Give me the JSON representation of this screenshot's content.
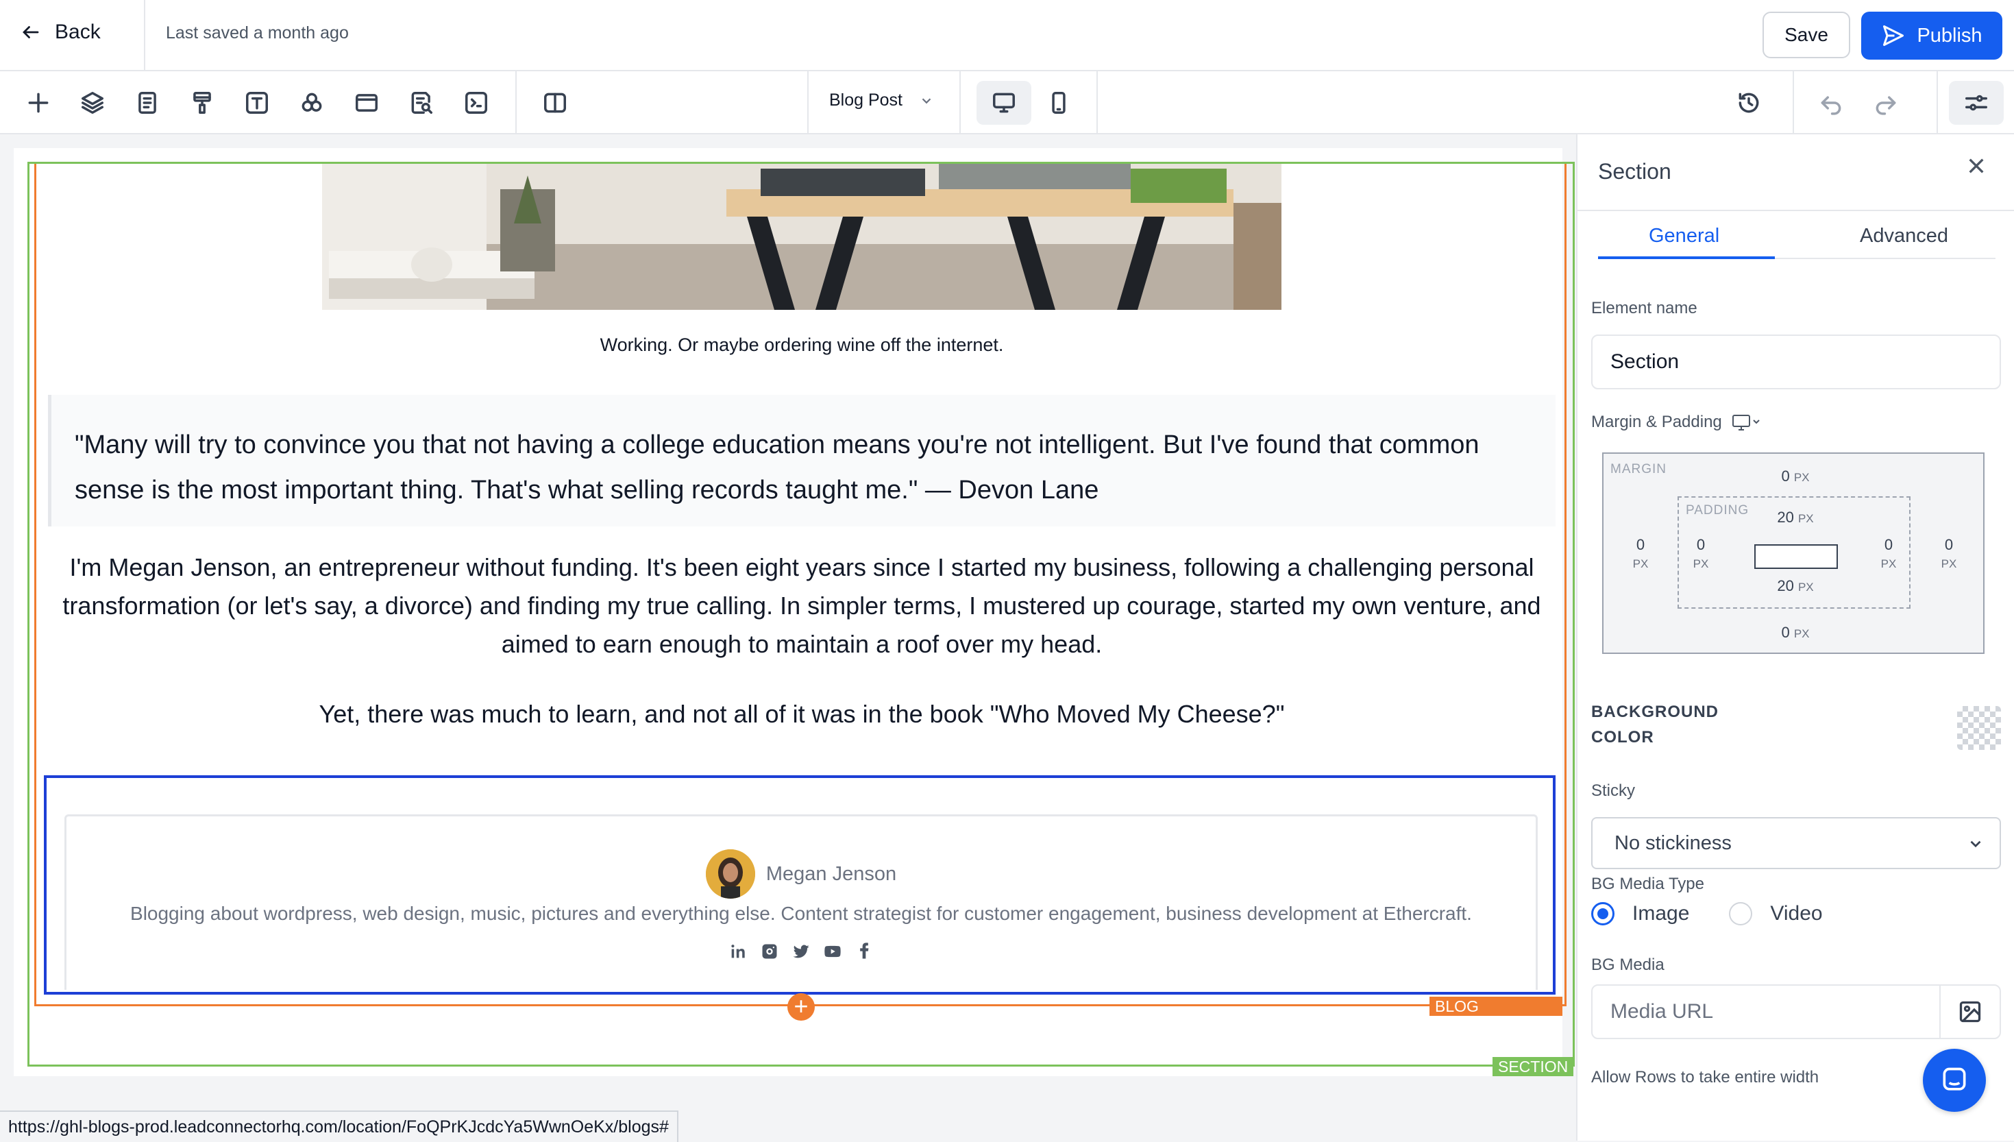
{
  "header": {
    "back_label": "Back",
    "last_saved": "Last saved a month ago",
    "save_label": "Save",
    "publish_label": "Publish"
  },
  "toolbar": {
    "page_select": "Blog Post",
    "left_icons": [
      "plus-icon",
      "layers-icon",
      "page-icon",
      "paint-roller-icon",
      "text-icon",
      "components-icon",
      "window-icon",
      "search-document-icon",
      "code-terminal-icon",
      "split-view-icon"
    ],
    "device": "desktop"
  },
  "canvas": {
    "caption": "Working. Or maybe ordering wine off the internet.",
    "quote": "\"Many will try to convince you that not having a college education means you're not intelligent. But I've found that common sense is the most important thing. That's what selling records taught me.\" — Devon Lane",
    "paragraph1": "I'm Megan Jenson, an entrepreneur without funding. It's been eight years since I started my business, following a challenging personal transformation (or let's say, a divorce) and finding my true calling. In simpler terms, I mustered up courage, started my own venture, and aimed to earn enough to maintain a roof over my head.",
    "paragraph2": "Yet, there was much to learn, and not all of it was in the book \"Who Moved My Cheese?\"",
    "author": {
      "name": "Megan Jenson",
      "bio": "Blogging about wordpress, web design, music, pictures and everything else. Content strategist for customer engagement, business development at Ethercraft.",
      "socials": [
        "linkedin-icon",
        "instagram-icon",
        "twitter-icon",
        "youtube-icon",
        "facebook-icon"
      ]
    },
    "tag_blog": "BLOG CONTENT",
    "tag_section": "SECTION",
    "add_symbol": "+"
  },
  "status_bar": {
    "url": "https://ghl-blogs-prod.leadconnectorhq.com/location/FoQPrKJcdcYa5WwnOeKx/blogs#"
  },
  "panel": {
    "title": "Section",
    "tabs": [
      "General",
      "Advanced"
    ],
    "active_tab": "General",
    "element_name_label": "Element name",
    "element_name_value": "Section",
    "margin_padding_label": "Margin & Padding",
    "margin_label": "MARGIN",
    "padding_label": "PADDING",
    "margin": {
      "top": "0",
      "right": "0",
      "bottom": "0",
      "left": "0"
    },
    "padding": {
      "top": "20",
      "right": "0",
      "bottom": "20",
      "left": "0"
    },
    "unit": "PX",
    "bg_color_label_1": "BACKGROUND",
    "bg_color_label_2": "COLOR",
    "sticky_label": "Sticky",
    "sticky_value": "No stickiness",
    "bg_media_type_label": "BG Media Type",
    "media_types": [
      "Image",
      "Video"
    ],
    "selected_media_type": "Image",
    "bg_media_label": "BG Media",
    "media_url_placeholder": "Media URL",
    "allow_rows_label": "Allow Rows to take entire width"
  },
  "colors": {
    "accent": "#155eef",
    "section_outline": "#7cc25b",
    "blog_outline": "#f07c2f",
    "selection": "#1d3fd6"
  }
}
